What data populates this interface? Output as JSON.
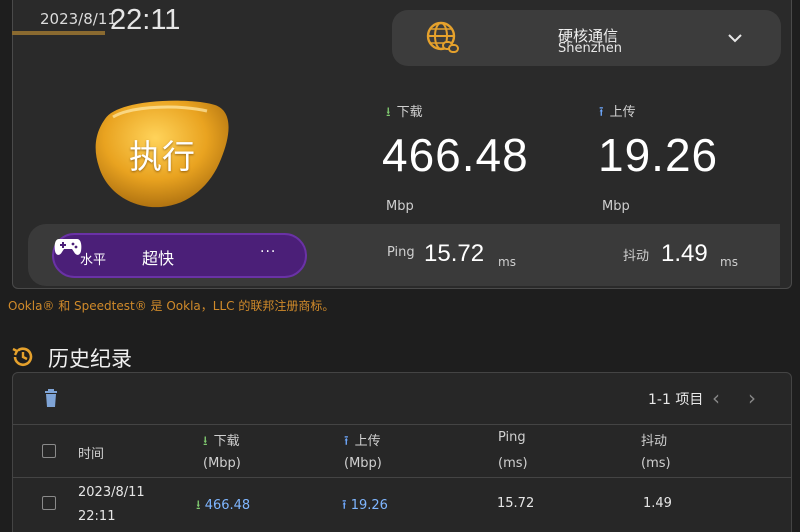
{
  "header": {
    "date": "2023/8/11",
    "time": "22:11"
  },
  "server": {
    "provider": "硬核通信",
    "city": "Shenzhen"
  },
  "go_button": {
    "label": "执行"
  },
  "download": {
    "label": "下载",
    "value": "466.48",
    "unit": "Mbp"
  },
  "upload": {
    "label": "上传",
    "value": "19.26",
    "unit": "Mbp"
  },
  "mode": {
    "label1": "水平",
    "label2": "超快",
    "more": "···"
  },
  "ping": {
    "label": "Ping",
    "value": "15.72",
    "unit": "ms"
  },
  "jitter": {
    "label": "抖动",
    "value": "1.49",
    "unit": "ms"
  },
  "legal": "Ookla® 和 Speedtest® 是 Ookla，LLC 的联邦注册商标。",
  "history": {
    "title": "历史纪录",
    "pager": "1-1 项目",
    "columns": {
      "time": "时间",
      "download": "下载",
      "upload": "上传",
      "ping": "Ping",
      "jitter": "抖动",
      "unit_mbp": "(Mbp)",
      "unit_ms": "(ms)"
    },
    "rows": [
      {
        "date": "2023/8/11",
        "time": "22:11",
        "download": "466.48",
        "upload": "19.26",
        "ping": "15.72",
        "jitter": "1.49"
      }
    ]
  },
  "colors": {
    "accent_gold": "#e8a52a",
    "mode_purple": "#4b1f78",
    "download_green": "#7fc96f",
    "upload_blue": "#6fa9ff"
  }
}
